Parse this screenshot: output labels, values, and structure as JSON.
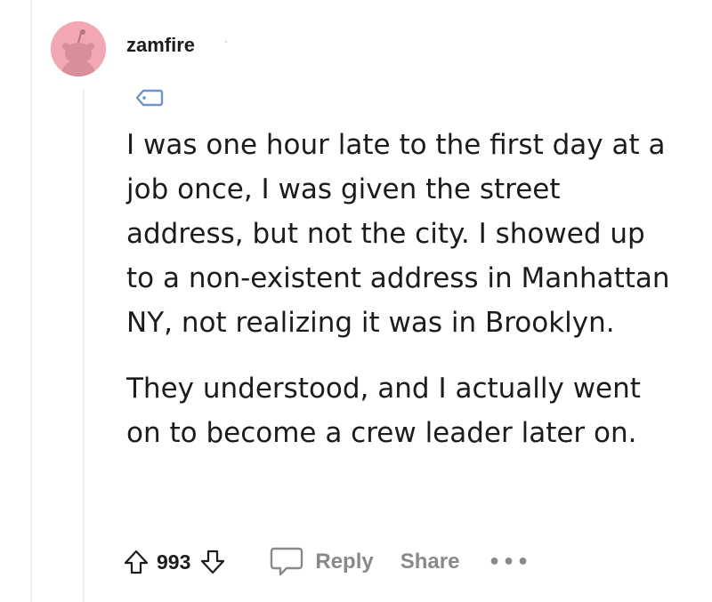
{
  "comment": {
    "username": "zamfire",
    "separator": "·",
    "flair_icon": "tag-icon",
    "paragraphs": [
      "I was one hour late to the first day at a job once, I was given the street address, but not the city. I showed up to a non-existent address in Manhattan NY, not realizing it was in Brooklyn.",
      "They understood, and I actually went on to become a crew leader later on."
    ]
  },
  "actions": {
    "upvote_icon": "arrow-up-icon",
    "score": "993",
    "downvote_icon": "arrow-down-icon",
    "reply_icon": "speech-bubble-icon",
    "reply_label": "Reply",
    "share_label": "Share",
    "more_label": "•••"
  },
  "colors": {
    "avatar_bg": "#f2a7b3",
    "muted_text": "#878a8c",
    "thread_line": "#edeff1",
    "icon_blue": "#7193c9"
  }
}
